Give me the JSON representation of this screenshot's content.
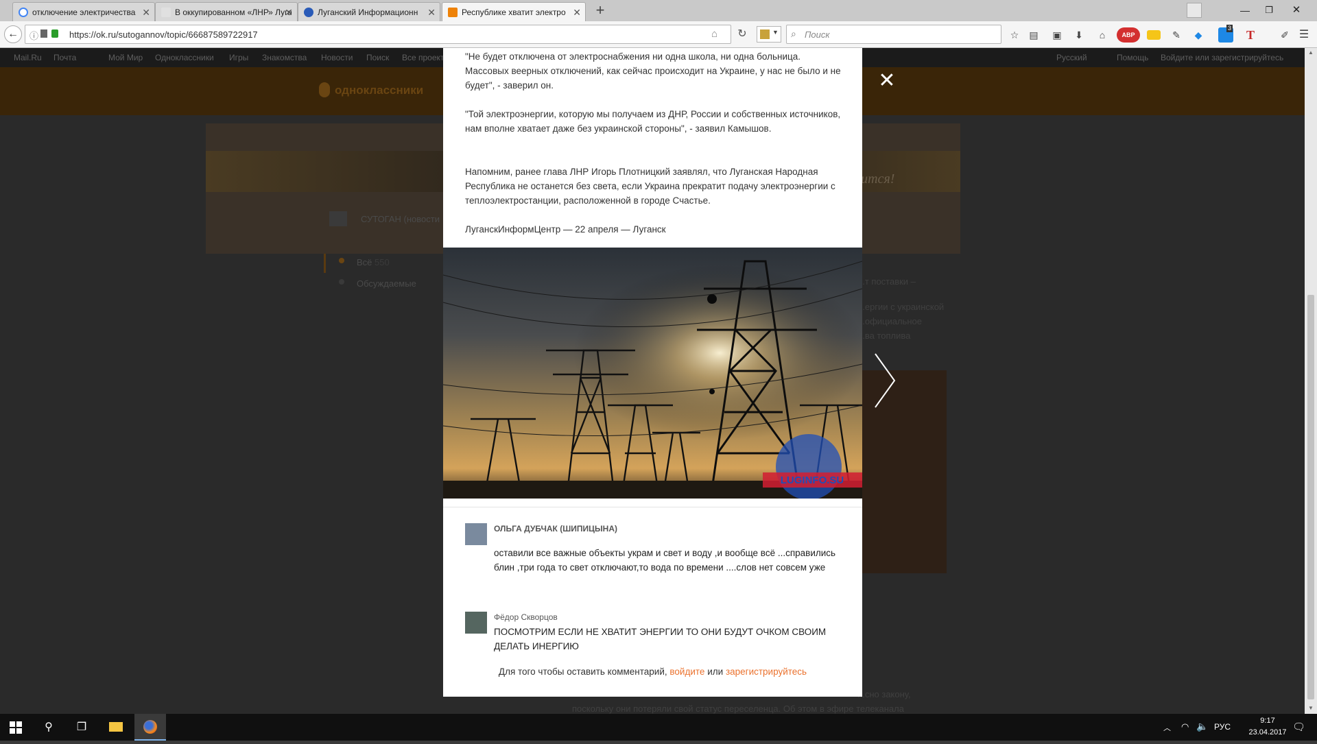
{
  "browser": {
    "tabs": [
      {
        "title": "отключение электричества",
        "icon_color": "#4285f4"
      },
      {
        "title": "В оккупированном «ЛНР» Луга",
        "icon_color": "#d8d8d8"
      },
      {
        "title": "Луганский Информационн",
        "icon_color": "#2a5bb8"
      },
      {
        "title": "Республике хватит электро",
        "icon_color": "#ee8208"
      }
    ],
    "new_tab": "+",
    "url": "https://ok.ru/sutogannov/topic/66687589722917",
    "search_placeholder": "Поиск"
  },
  "background_page": {
    "topnav": [
      "Mail.Ru",
      "Почта",
      "Мой Мир",
      "Одноклассники",
      "Игры",
      "Знакомства",
      "Новости",
      "Поиск",
      "Все проекты"
    ],
    "topnav_right": [
      "Русский",
      "Помощь",
      "Войдите или зарегистрируйтесь"
    ],
    "logo": "одноклассники",
    "banner_text": "...дится!",
    "group_name": "СУТОГАН (новости",
    "filter_all": "Всё",
    "filter_all_count": "550",
    "filter_discussed": "Обсуждаемые",
    "feed_lines": [
      "...т поставки –",
      "...ергии с украинской",
      "...официальное",
      "...ва топлива"
    ],
    "bottom_lines": [
      "...сно закону,",
      "поскольку они потеряли свой статус переселенца. Об этом в эфире телеканала"
    ]
  },
  "modal": {
    "paragraphs": [
      "\"Не будет отключена от электроснабжения ни одна школа, ни одна больница. Массовых веерных отключений, как сейчас происходит на Украине, у нас не было и не будет\", - заверил он.",
      "\"Той электроэнергии, которую мы получаем из ДНР, России и собственных источников, нам вполне хватает даже без украинской стороны\", - заявил Камышов.",
      "Напомним, ранее глава ЛНР Игорь Плотницкий заявлял, что Луганская Народная Республика не останется без света, если Украина прекратит подачу электроэнергии с теплоэлектростанции, расположенной в городе Счастье."
    ],
    "source": "ЛуганскИнформЦентр — 22 апреля — Луганск",
    "photo_watermark": "LUGINFO.SU",
    "comments": [
      {
        "author": "ОЛЬГА ДУБЧАК (ШИПИЦЫНА)",
        "text": "оставили все важные объекты украм и свет и воду ,и вообще всё ...справились блин ,три года то свет отключают,то вода по времени ....слов нет совсем уже"
      },
      {
        "author": "Фёдор Скворцов",
        "text": "ПОСМОТРИМ ЕСЛИ НЕ ХВАТИТ ЭНЕРГИИ ТО ОНИ БУДУТ ОЧКОМ СВОИМ ДЕЛАТЬ ИНЕРГИЮ"
      }
    ],
    "login_prompt": {
      "prefix": "Для того чтобы оставить комментарий,",
      "login": "войдите",
      "or": "или",
      "register": "зарегистрируйтесь"
    },
    "close": "✕"
  },
  "taskbar": {
    "language": "РУС",
    "time": "9:17",
    "date": "23.04.2017",
    "addon_badge": "3"
  },
  "colors": {
    "link": "#eb722e",
    "ok_orange": "#ee8208"
  }
}
